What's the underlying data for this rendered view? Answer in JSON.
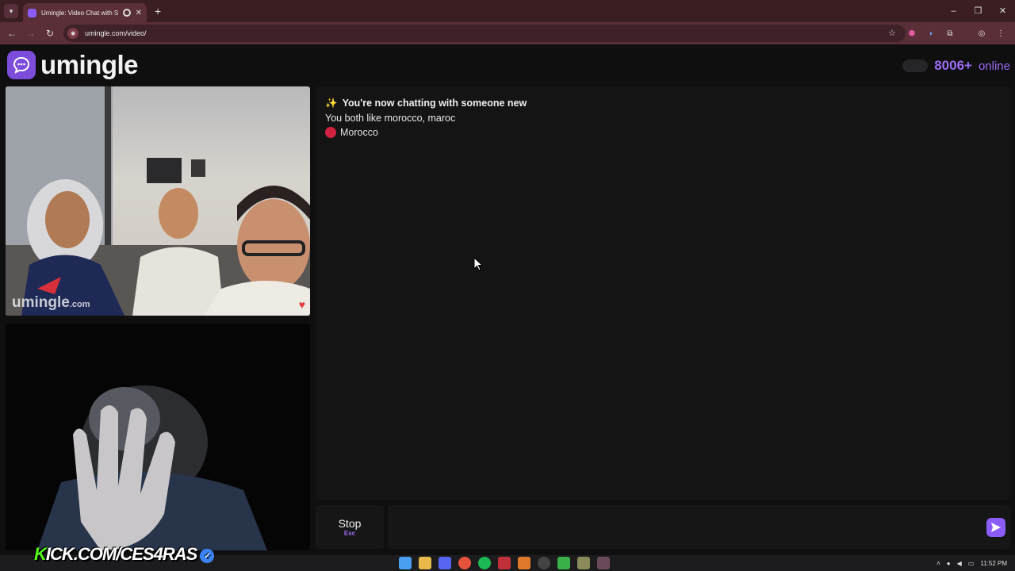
{
  "browser": {
    "tab_title": "Umingle: Video Chat with S",
    "new_tab": "+",
    "url": "umingle.com/video/",
    "window_controls": {
      "minimize": "–",
      "restore": "❐",
      "close": "✕"
    }
  },
  "header": {
    "logo_text": "umingle",
    "online_count": "8006+",
    "online_label": "online"
  },
  "stranger_video": {
    "watermark": "umingle",
    "watermark_suffix": ".com"
  },
  "chat": {
    "sparkle": "✨",
    "intro": "You're now chatting with someone new",
    "common_interests": "You both like morocco, maroc",
    "country": "Morocco"
  },
  "controls": {
    "stop_label": "Stop",
    "stop_shortcut": "Esc",
    "message_placeholder": ""
  },
  "overlay": {
    "kick_k": "K",
    "kick_rest": "ICK.COM/CES4RAS"
  },
  "taskbar": {
    "time": "11:52 PM"
  },
  "colors": {
    "brand_purple": "#8b5cf6",
    "online_purple": "#9b6cf2",
    "browser_frame": "#5a2f38",
    "flag_red": "#d0223f",
    "kick_green": "#53fc18"
  },
  "icons": [
    "tab-menu-icon",
    "close-icon",
    "back-icon",
    "forward-icon",
    "reload-icon",
    "star-icon",
    "extensions-icon",
    "profile-icon",
    "menu-icon",
    "chat-bubble-icon",
    "send-icon",
    "verified-icon"
  ]
}
